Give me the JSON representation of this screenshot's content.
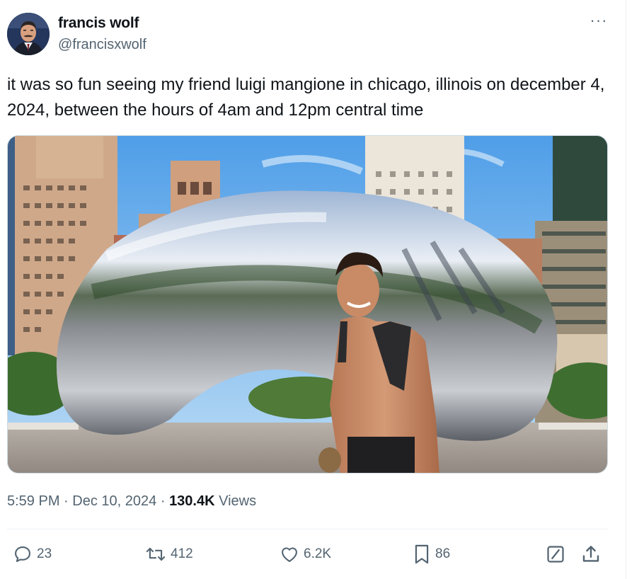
{
  "author": {
    "display_name": "francis wolf",
    "handle": "@francisxwolf"
  },
  "more_label": "···",
  "tweet": {
    "text": "it was so fun seeing my friend luigi mangione in chicago, illinois on december 4, 2024, between the hours of 4am and 12pm central time"
  },
  "meta": {
    "time": "5:59 PM",
    "separator": "·",
    "date": "Dec 10, 2024",
    "views_count": "130.4K",
    "views_label": "Views"
  },
  "actions": {
    "replies": "23",
    "retweets": "412",
    "likes": "6.2K",
    "bookmarks": "86"
  },
  "colors": {
    "text_primary": "#0f1419",
    "text_secondary": "#536471",
    "divider": "#eff3f4"
  },
  "icons": [
    "reply-icon",
    "retweet-icon",
    "like-icon",
    "bookmark-icon",
    "grok-icon",
    "share-icon",
    "more-icon"
  ]
}
